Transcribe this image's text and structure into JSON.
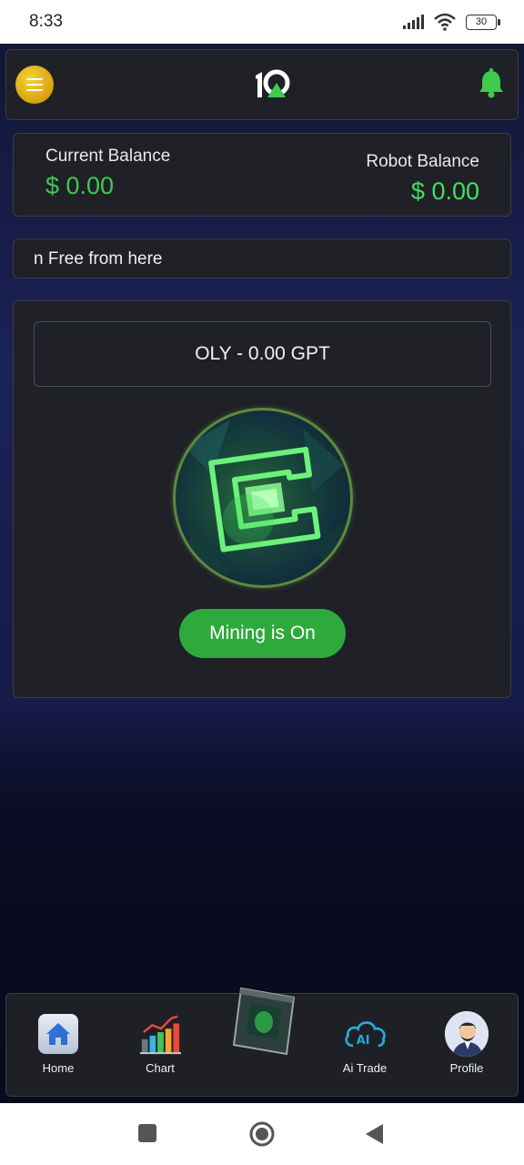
{
  "status_bar": {
    "time": "8:33",
    "battery": "30"
  },
  "header": {
    "menu_icon": "hamburger-menu-icon",
    "logo_text": "10",
    "bell_icon": "bell-icon",
    "accent": "#2eaa3d"
  },
  "balance": {
    "current_label": "Current Balance",
    "current_value": "$ 0.00",
    "robot_label": "Robot Balance",
    "robot_value": "$ 0.00"
  },
  "marquee": {
    "text": "n Free from here"
  },
  "mining": {
    "coin_label": "OLY - 0.00 GPT",
    "status_button": "Mining is On"
  },
  "bottom_nav": {
    "items": [
      {
        "label": "Home",
        "icon": "home-icon"
      },
      {
        "label": "Chart",
        "icon": "chart-icon"
      },
      {
        "label": "",
        "icon": "mining-cube-icon"
      },
      {
        "label": "Ai Trade",
        "icon": "ai-cloud-icon"
      },
      {
        "label": "Profile",
        "icon": "profile-avatar-icon"
      }
    ]
  },
  "system_nav": {
    "icons": [
      "recents-square-icon",
      "home-circle-icon",
      "back-triangle-icon"
    ]
  }
}
